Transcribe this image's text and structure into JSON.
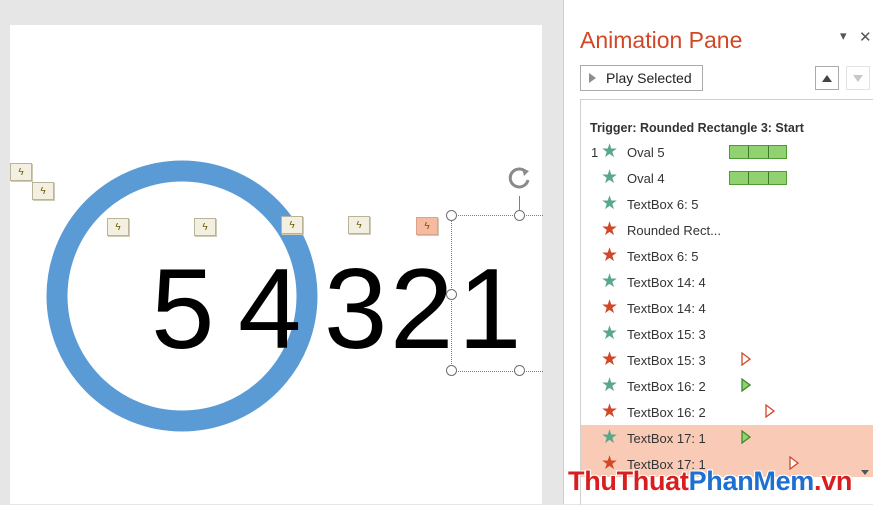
{
  "slide": {
    "digits": [
      "5",
      "4",
      "3",
      "2",
      "1"
    ]
  },
  "pane": {
    "title": "Animation Pane",
    "play_selected_label": "Play Selected",
    "trigger_heading": "Trigger: Rounded Rectangle 3: Start",
    "items": [
      {
        "num": "1",
        "name": "Oval 5",
        "star_color": "#5aa88a",
        "timing_bar": true
      },
      {
        "num": "",
        "name": "Oval 4",
        "star_color": "#5aa88a",
        "timing_bar": true
      },
      {
        "num": "",
        "name": "TextBox 6: 5",
        "star_color": "#5aa88a"
      },
      {
        "num": "",
        "name": "Rounded Rect...",
        "star_color": "#d24726"
      },
      {
        "num": "",
        "name": "TextBox 6: 5",
        "star_color": "#d24726"
      },
      {
        "num": "",
        "name": "TextBox 14: 4",
        "star_color": "#5aa88a"
      },
      {
        "num": "",
        "name": "TextBox 14: 4",
        "star_color": "#d24726"
      },
      {
        "num": "",
        "name": "TextBox 15: 3",
        "star_color": "#5aa88a"
      },
      {
        "num": "",
        "name": "TextBox 15: 3",
        "star_color": "#d24726",
        "marker": "red"
      },
      {
        "num": "",
        "name": "TextBox 16: 2",
        "star_color": "#5aa88a",
        "marker": "green"
      },
      {
        "num": "",
        "name": "TextBox 16: 2",
        "star_color": "#d24726",
        "marker": "red"
      },
      {
        "num": "",
        "name": "TextBox 17: 1",
        "star_color": "#5aa88a",
        "marker": "green",
        "highlight": true
      },
      {
        "num": "",
        "name": "TextBox 17: 1",
        "star_color": "#d24726",
        "marker": "red",
        "highlight": true
      }
    ]
  },
  "watermark": {
    "part1": "ThuThuat",
    "part2": "PhanMem",
    "part3": ".vn"
  },
  "colors": {
    "title": "#d24726",
    "ring": "#5b9bd5",
    "highlight": "#f9cbb7"
  }
}
